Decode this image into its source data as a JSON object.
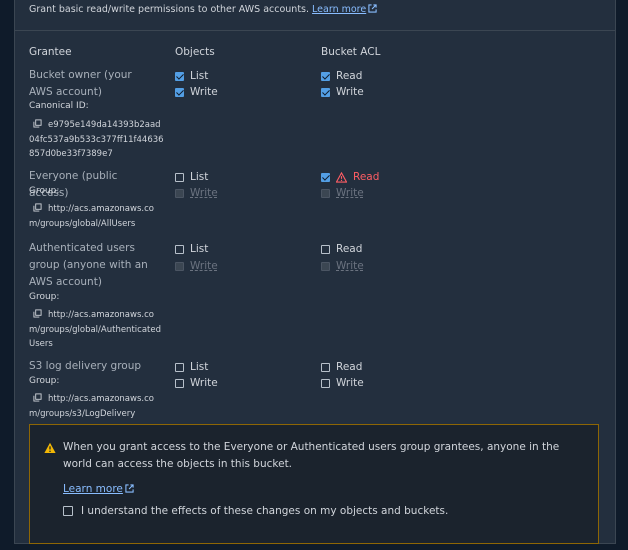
{
  "intro": {
    "text": "Grant basic read/write permissions to other AWS accounts.",
    "link": "Learn more"
  },
  "headers": {
    "grantee": "Grantee",
    "objects": "Objects",
    "bucket_acl": "Bucket ACL"
  },
  "grantees": [
    {
      "name": "Bucket owner (your AWS account)",
      "type": "Canonical ID:",
      "id": "e9795e149da14393b2aad04fc537a9b533c377ff11f44636857d0be33f7389e7",
      "objects": {
        "list": "List",
        "write": "Write"
      },
      "acl": {
        "read": "Read",
        "write": "Write"
      }
    },
    {
      "name": "Everyone (public access)",
      "type": "Group:",
      "id": "http://acs.amazonaws.com/groups/global/AllUsers",
      "objects": {
        "list": "List",
        "write": "Write"
      },
      "acl": {
        "read": "Read",
        "write": "Write"
      }
    },
    {
      "name": "Authenticated users group (anyone with an AWS account)",
      "type": "Group:",
      "id": "http://acs.amazonaws.com/groups/global/AuthenticatedUsers",
      "objects": {
        "list": "List",
        "write": "Write"
      },
      "acl": {
        "read": "Read",
        "write": "Write"
      }
    },
    {
      "name": "S3 log delivery group",
      "type": "Group:",
      "id": "http://acs.amazonaws.com/groups/s3/LogDelivery",
      "objects": {
        "list": "List",
        "write": "Write"
      },
      "acl": {
        "read": "Read",
        "write": "Write"
      }
    }
  ],
  "alert": {
    "text": "When you grant access to the Everyone or Authenticated users group grantees, anyone in the world can access the objects in this bucket.",
    "link": "Learn more",
    "checkbox_label": "I understand the effects of these changes on my objects and buckets."
  },
  "colors": {
    "accent": "#539fe5",
    "link": "#89bdff",
    "warning": "#ff5d64",
    "alert_border": "#8d6605"
  }
}
